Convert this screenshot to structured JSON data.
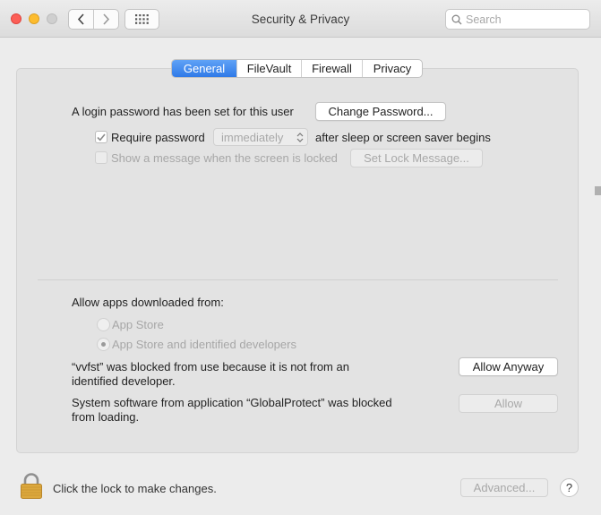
{
  "window": {
    "title": "Security & Privacy"
  },
  "toolbar": {
    "back_icon": "chevron-left-icon",
    "forward_icon": "chevron-right-icon",
    "show_all_icon": "grid-icon"
  },
  "search": {
    "placeholder": "Search",
    "value": ""
  },
  "tabs": [
    {
      "label": "General",
      "active": true
    },
    {
      "label": "FileVault",
      "active": false
    },
    {
      "label": "Firewall",
      "active": false
    },
    {
      "label": "Privacy",
      "active": false
    }
  ],
  "general": {
    "login_password_text": "A login password has been set for this user",
    "change_password_label": "Change Password...",
    "require_password": {
      "checked": true,
      "label": "Require password",
      "interval": "immediately",
      "suffix": "after sleep or screen saver begins"
    },
    "show_message": {
      "checked": false,
      "label": "Show a message when the screen is locked",
      "button_label": "Set Lock Message..."
    },
    "allow_apps": {
      "heading": "Allow apps downloaded from:",
      "options": [
        {
          "label": "App Store",
          "selected": false
        },
        {
          "label": "App Store and identified developers",
          "selected": true
        }
      ]
    },
    "blocked_app": {
      "text_line1": "“vvfst” was blocked from use because it is not from an",
      "text_line2": "identified developer.",
      "button_label": "Allow Anyway"
    },
    "blocked_system": {
      "text_line1": "System software from application “GlobalProtect” was blocked",
      "text_line2": "from loading.",
      "button_label": "Allow"
    }
  },
  "footer": {
    "lock_text": "Click the lock to make changes.",
    "advanced_label": "Advanced...",
    "help_label": "?"
  },
  "colors": {
    "accent": "#3478f6",
    "close": "#fc5f57",
    "minimize": "#fdbc2e",
    "panel": "#e3e3e3",
    "lock_gold": "#d9a53a"
  }
}
